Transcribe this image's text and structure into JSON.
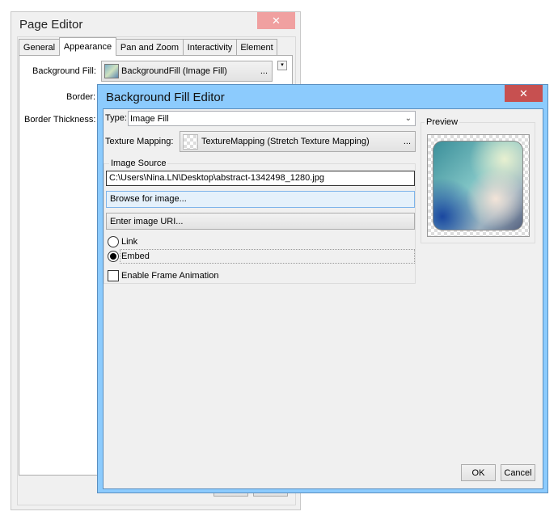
{
  "page_editor": {
    "title": "Page Editor",
    "close_glyph": "✕",
    "tabs": [
      "General",
      "Appearance",
      "Pan and Zoom",
      "Interactivity",
      "Element"
    ],
    "selected_tab": "Appearance",
    "background_fill_label": "Background Fill:",
    "background_fill_value": "BackgroundFill (Image Fill)",
    "ellipsis": "...",
    "border_label": "Border:",
    "border_thickness_label": "Border Thickness:"
  },
  "fill_editor": {
    "title": "Background Fill Editor",
    "close_glyph": "✕",
    "type_label": "Type:",
    "type_value": "Image Fill",
    "texture_mapping_label": "Texture Mapping:",
    "texture_mapping_value": "TextureMapping (Stretch Texture Mapping)",
    "ellipsis": "...",
    "image_source_legend": "Image Source",
    "image_path": "C:\\Users\\Nina.LN\\Desktop\\abstract-1342498_1280.jpg",
    "browse_label": "Browse for image...",
    "enter_uri_label": "Enter image URI...",
    "link_label": "Link",
    "embed_label": "Embed",
    "selected_mode": "Embed",
    "frame_animation_label": "Enable Frame Animation",
    "frame_animation_checked": false,
    "preview_legend": "Preview",
    "ok_label": "OK",
    "cancel_label": "Cancel"
  },
  "colors": {
    "dialog_frame": "#8ccbfd",
    "close_active": "#c75050",
    "close_inactive": "#f0a0a0",
    "browse_hover": "#e5f1fb"
  }
}
